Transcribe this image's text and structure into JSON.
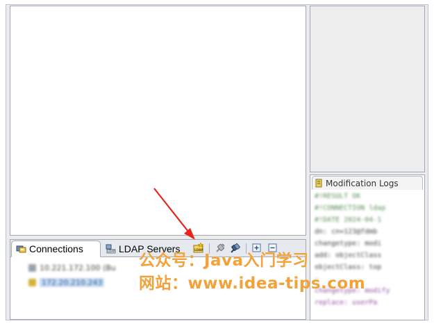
{
  "views": {
    "bottom_tabs": [
      {
        "label": "Connections",
        "icon": "connections-icon",
        "active": true
      },
      {
        "label": "LDAP Servers",
        "icon": "ldap-servers-icon",
        "active": false
      }
    ],
    "modifications_tab": {
      "label": "Modification Logs",
      "icon": "modification-logs-icon"
    }
  },
  "toolbar": {
    "new_connection_icon": "new-ldap-connection-icon",
    "open_connection_icon": "open-connection-icon",
    "close_connection_icon": "close-connection-icon",
    "expand_all_icon": "expand-all-icon",
    "collapse_all_icon": "collapse-all-icon"
  },
  "connections_tree": {
    "items": [
      {
        "label": "10.221.172.100 (Bu",
        "selected": false,
        "icon_color": "#9aa3ad"
      },
      {
        "label": "172.20.210.243",
        "selected": true,
        "icon_color": "#d4b23a"
      }
    ]
  },
  "modification_log_lines": [
    {
      "text": "#!RESULT OK",
      "style": "green"
    },
    {
      "text": "#!CONNECTION ldap",
      "style": "green"
    },
    {
      "text": "#!DATE 2024-04-1",
      "style": "green"
    },
    {
      "text": "dn: cn=123@fdmb",
      "style": "dark"
    },
    {
      "text": "changetype: modi",
      "style": "dark"
    },
    {
      "text": "add: objectClass",
      "style": "dark"
    },
    {
      "text": "objectClass: top",
      "style": "dark"
    },
    {
      "text": "-",
      "style": "dark"
    },
    {
      "text": "changetype: modify",
      "style": "purple"
    },
    {
      "text": "replace: userPa",
      "style": "purple"
    }
  ],
  "watermark": {
    "line1": "公众号：Java入门学习",
    "line2": "网站：www.idea-tips.com",
    "color": "#f2a23a"
  },
  "colors": {
    "annotation_arrow": "#e8231e",
    "panel_border": "#a0a8b3",
    "selection": "#c9dcf2"
  }
}
